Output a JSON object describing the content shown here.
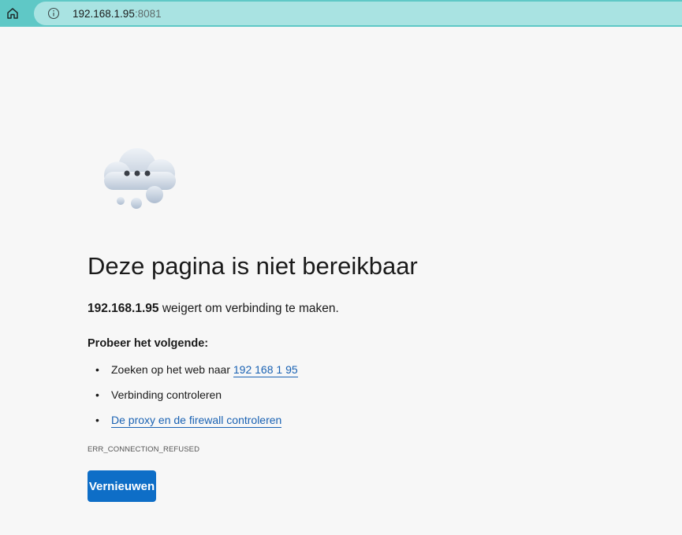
{
  "browser": {
    "home_icon": "home-icon",
    "info_icon": "info-icon",
    "address": {
      "host": "192.168.1.95",
      "port": ":8081"
    }
  },
  "error_page": {
    "illustration": "thought-cloud-icon",
    "title": "Deze pagina is niet bereikbaar",
    "host_bold": "192.168.1.95",
    "message": " weigert om verbinding te maken.",
    "try_heading": "Probeer het volgende:",
    "suggestions": [
      {
        "prefix": "Zoeken op het web naar ",
        "link": "192 168 1 95"
      },
      {
        "text": "Verbinding controleren"
      },
      {
        "link": "De proxy en de firewall controleren"
      }
    ],
    "error_code": "ERR_CONNECTION_REFUSED",
    "reload_label": "Vernieuwen"
  },
  "colors": {
    "toolbar": "#5fc8c6",
    "address_bar": "#a9e3e2",
    "page_background": "#f7f7f7",
    "link": "#1a62b3",
    "button": "#0e6ec7"
  }
}
